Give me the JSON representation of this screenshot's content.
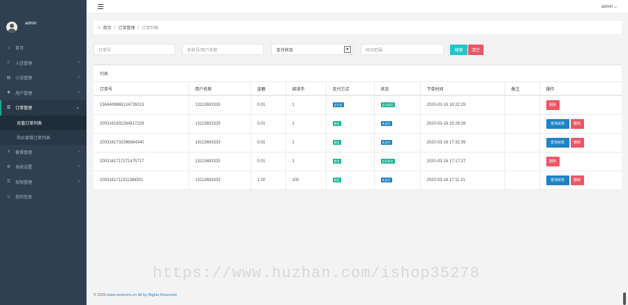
{
  "profile": {
    "name": "admin"
  },
  "topbar": {
    "admin_label": "admin ⌄"
  },
  "sidebar": {
    "items": [
      {
        "label": "首页",
        "icon": "home-icon",
        "glyph": "⌂",
        "has_children": false
      },
      {
        "label": "入驻管理",
        "icon": "user-icon",
        "glyph": "☺",
        "has_children": true
      },
      {
        "label": "小说管理",
        "icon": "book-icon",
        "glyph": "▤",
        "has_children": true
      },
      {
        "label": "用户管理",
        "icon": "users-icon",
        "glyph": "☻",
        "has_children": true
      },
      {
        "label": "订单管理",
        "icon": "list-icon",
        "glyph": "☰",
        "has_children": true,
        "active": true
      },
      {
        "label": "套餐管理",
        "icon": "layers-icon",
        "glyph": "≡",
        "has_children": true
      },
      {
        "label": "系统设置",
        "icon": "gear-icon",
        "glyph": "⚙",
        "has_children": true
      },
      {
        "label": "权限管理",
        "icon": "key-icon",
        "glyph": "⚿",
        "has_children": true
      },
      {
        "label": "我的信息",
        "icon": "person-icon",
        "glyph": "☺",
        "has_children": false
      }
    ],
    "sub_items": [
      "充值订单列表",
      "购买套餐订单列表"
    ]
  },
  "breadcrumb": {
    "home": "首页",
    "parent": "订单管理",
    "current": "订单列表"
  },
  "filters": {
    "order_no_placeholder": "订单号",
    "user_placeholder": "手机号/用户名称",
    "pay_status": "支付状态",
    "date_placeholder": "时间范围",
    "search_label": "搜索",
    "clear_label": "清空"
  },
  "panel": {
    "title": "列表"
  },
  "table": {
    "headers": [
      "订单号",
      "用户名称",
      "金额",
      "阅读币",
      "支付方式",
      "状态",
      "下单时间",
      "备注",
      "操作"
    ],
    "rows": [
      {
        "order_no": "1584409865124726013",
        "user": "13113693333",
        "amount": "0.01",
        "coins": "1",
        "pay_method": "支付宝",
        "pay_color": "blue",
        "status": "支付成功",
        "status_color": "green",
        "time": "2020-03-16 18:22:29",
        "note": "",
        "actions": [
          "删除"
        ]
      },
      {
        "order_no": "2003161832264617229",
        "user": "13113693333",
        "amount": "0.01",
        "coins": "1",
        "pay_method": "微信",
        "pay_color": "green",
        "status": "未支付",
        "status_color": "blue",
        "time": "2020-03-16 18:29:28",
        "note": "",
        "actions": [
          "查询状态",
          "删除"
        ]
      },
      {
        "order_no": "2003161732396684340",
        "user": "13113693333",
        "amount": "0.01",
        "coins": "1",
        "pay_method": "微信",
        "pay_color": "green",
        "status": "未支付",
        "status_color": "blue",
        "time": "2020-03-16 17:32:39",
        "note": "",
        "actions": [
          "查询状态",
          "删除"
        ]
      },
      {
        "order_no": "2003161717271475717",
        "user": "13113693333",
        "amount": "0.01",
        "coins": "1",
        "pay_method": "微信",
        "pay_color": "green",
        "status": "支付成功",
        "status_color": "green",
        "time": "2020-03-16 17:17:27",
        "note": "",
        "actions": [
          "删除"
        ]
      },
      {
        "order_no": "2003161711311368501",
        "user": "13113693333",
        "amount": "1.00",
        "coins": "100",
        "pay_method": "微信",
        "pay_color": "green",
        "status": "未支付",
        "status_color": "blue",
        "time": "2020-03-16 17:11:31",
        "note": "",
        "actions": [
          "查询状态",
          "删除"
        ]
      }
    ]
  },
  "footer": {
    "copyright": "© 2020",
    "site": "www.unoncms.cn",
    "rights": "All by Rights Reserved"
  },
  "watermark": "https://www.huzhan.com/ishop35278",
  "colors": {
    "sidebar": "#2f4050",
    "accent": "#19aa8d",
    "blue": "#1c84c6",
    "red": "#ed5565",
    "cyan": "#23c6c8"
  }
}
